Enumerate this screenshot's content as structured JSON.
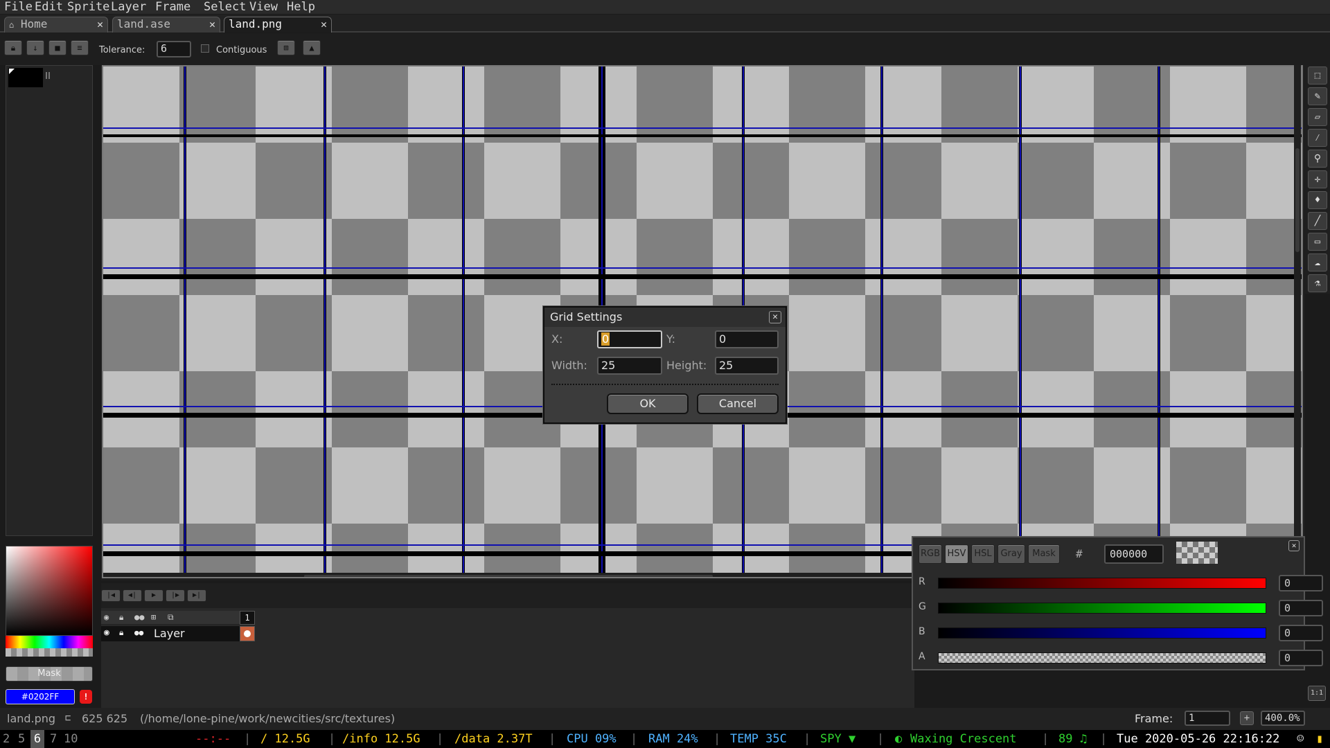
{
  "menu": {
    "items": [
      "File",
      "Edit",
      "Sprite",
      "Layer",
      "Frame",
      "Select",
      "View",
      "Help"
    ]
  },
  "tabs": [
    {
      "label": "Home",
      "icon": "home-icon"
    },
    {
      "label": "land.ase"
    },
    {
      "label": "land.png",
      "active": true
    }
  ],
  "context_bar": {
    "tolerance_label": "Tolerance:",
    "tolerance_value": "6",
    "contiguous_label": "Contiguous"
  },
  "dialog": {
    "title": "Grid Settings",
    "x_label": "X:",
    "x_value": "0",
    "y_label": "Y:",
    "y_value": "0",
    "width_label": "Width:",
    "width_value": "25",
    "height_label": "Height:",
    "height_value": "25",
    "ok_label": "OK",
    "cancel_label": "Cancel"
  },
  "timeline": {
    "frame_number": "1",
    "layer_name": "Layer"
  },
  "left_panel": {
    "mask_label": "Mask",
    "fg_color_label": "#0202FF"
  },
  "color_panel": {
    "modes": [
      "RGB",
      "HSV",
      "HSL",
      "Gray",
      "Mask"
    ],
    "selected_mode": "HSV",
    "hash_label": "#",
    "hex_value": "000000",
    "channels": [
      {
        "label": "R",
        "value": "0"
      },
      {
        "label": "G",
        "value": "0"
      },
      {
        "label": "B",
        "value": "0"
      },
      {
        "label": "A",
        "value": "0"
      }
    ]
  },
  "status": {
    "filename": "land.png",
    "size": "625 625",
    "path": "(/home/lone-pine/work/newcities/src/textures)",
    "frame_label": "Frame:",
    "frame_value": "1",
    "zoom": "400.0%"
  },
  "taskbar": {
    "workspaces": [
      "2",
      "5",
      "6",
      "7",
      "10"
    ],
    "active_workspace": "6",
    "media": "--:--",
    "disk_root": "/ 12.5G",
    "disk_info": "/info 12.5G",
    "disk_data": "/data 2.37T",
    "cpu": "CPU 09%",
    "ram": "RAM 24%",
    "temp": "TEMP 35C",
    "spy": "SPY ▼",
    "moon": "Waxing Crescent",
    "volume": "89 ♫",
    "datetime": "Tue 2020-05-26 22:16:22"
  },
  "colors": {
    "grid_line": "#1010b0",
    "grid_thick": "#000000",
    "checker_light": "#c0c0c0",
    "checker_dark": "#808080",
    "fg_color": "#0202ff",
    "taskbar_accent": "#4fb2ff"
  }
}
